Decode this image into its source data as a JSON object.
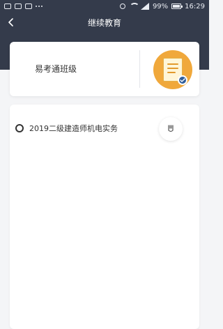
{
  "status_bar": {
    "battery": "99%",
    "time": "16:29",
    "icons": [
      "image-icon",
      "gallery-icon",
      "bag-icon",
      "dots-icon",
      "vibrate-icon",
      "wifi-icon",
      "signal-icon",
      "battery-icon"
    ]
  },
  "nav": {
    "title": "继续教育",
    "back_icon": "chevron-left-icon"
  },
  "class_card": {
    "title": "易考通班级",
    "icon": "document-check-icon",
    "icon_color": "#f0a83b",
    "check_color": "#2f5d9a"
  },
  "course_list": {
    "items": [
      {
        "label": "2019二级建造师机电实务",
        "selected": false,
        "action_icon": "edit-icon"
      }
    ]
  },
  "colors": {
    "header": "#343b4b",
    "background": "#f4f5f7",
    "card": "#ffffff"
  }
}
